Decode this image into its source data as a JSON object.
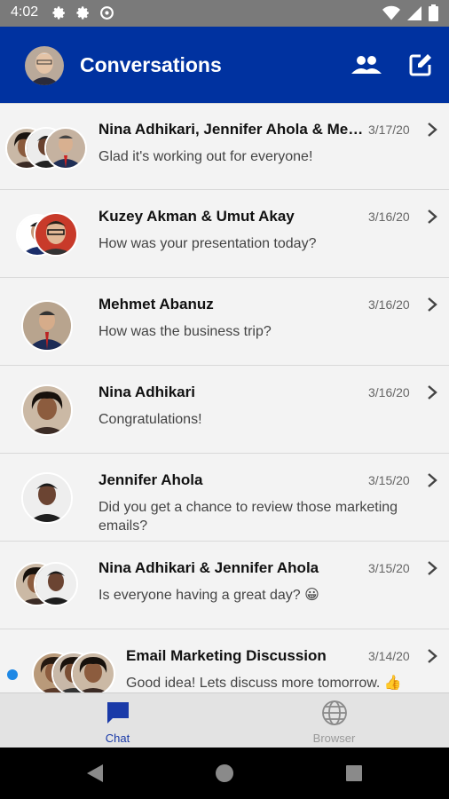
{
  "status_bar": {
    "time": "4:02",
    "left_icons": [
      "gear-icon",
      "gear-icon",
      "circle-a-icon"
    ],
    "right_icons": [
      "wifi-icon",
      "cell-signal-icon",
      "battery-icon"
    ]
  },
  "header": {
    "title": "Conversations",
    "actions": [
      "people-icon",
      "compose-icon"
    ],
    "background": "#0032a0"
  },
  "conversations": [
    {
      "name": "Nina Adhikari, Jennifer Ahola & Mehmet Abanuz",
      "date": "3/17/20",
      "preview": "Glad it's working out for everyone!",
      "avatars": 3,
      "unread": false
    },
    {
      "name": "Kuzey Akman & Umut Akay",
      "date": "3/16/20",
      "preview": "How was your presentation today?",
      "avatars": 2,
      "unread": false
    },
    {
      "name": "Mehmet Abanuz",
      "date": "3/16/20",
      "preview": "How was the business trip?",
      "avatars": 1,
      "unread": false
    },
    {
      "name": "Nina Adhikari",
      "date": "3/16/20",
      "preview": "Congratulations!",
      "avatars": 1,
      "unread": false
    },
    {
      "name": "Jennifer Ahola",
      "date": "3/15/20",
      "preview": "Did you get a chance to review those marketing emails?",
      "avatars": 1,
      "unread": false
    },
    {
      "name": "Nina Adhikari & Jennifer Ahola",
      "date": "3/15/20",
      "preview": "Is everyone having a great day? 😀",
      "avatars": 2,
      "unread": false
    },
    {
      "name": "Email Marketing Discussion",
      "date": "3/14/20",
      "preview": "Good idea! Lets discuss more tomorrow. 👍",
      "avatars": 3,
      "unread": true
    }
  ],
  "bottom_nav": {
    "tabs": [
      {
        "label": "Chat",
        "icon": "chat-bubble-icon",
        "active": true
      },
      {
        "label": "Browser",
        "icon": "globe-icon",
        "active": false
      }
    ],
    "active_color": "#1a3aa8"
  },
  "system_nav": [
    "back-icon",
    "home-icon",
    "recents-icon"
  ]
}
